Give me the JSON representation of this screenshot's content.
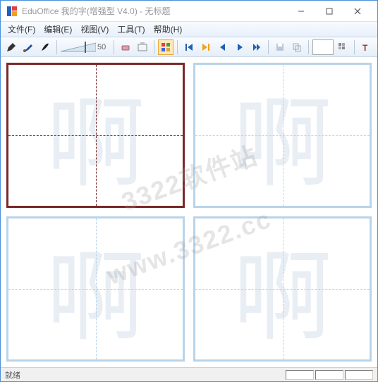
{
  "window": {
    "title": "EduOffice 我的字(增强型 V4.0) - 无标题"
  },
  "menubar": {
    "file": "文件(F)",
    "edit": "编辑(E)",
    "view": "视图(V)",
    "tools": "工具(T)",
    "help": "帮助(H)"
  },
  "toolbar": {
    "brush_size": "50"
  },
  "canvas": {
    "ghost_char": "啊",
    "watermark1": "3322软件站",
    "watermark2": "www.3322.cc"
  },
  "statusbar": {
    "ready": "就绪"
  }
}
